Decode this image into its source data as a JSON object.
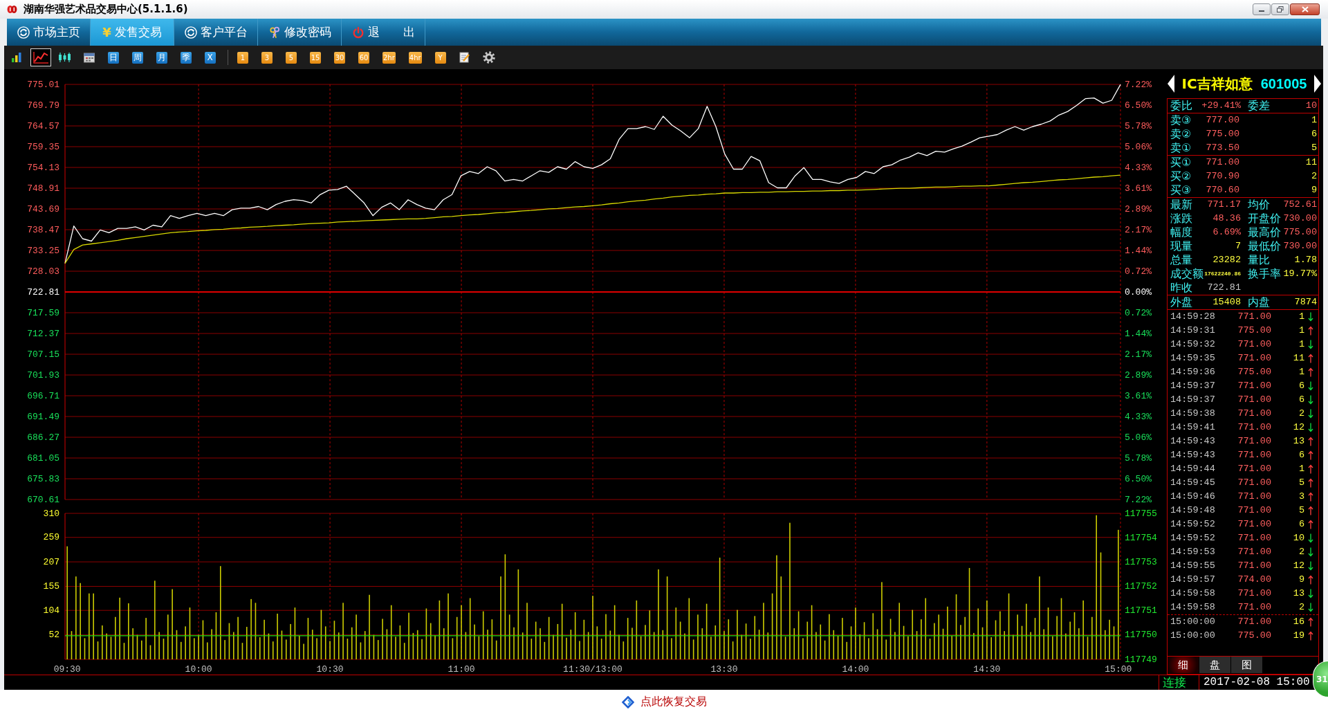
{
  "window": {
    "title": "湖南华强艺术品交易中心(5.1.1.6)"
  },
  "menu": [
    {
      "label": "市场主页",
      "kind": "refresh",
      "selected": false
    },
    {
      "label": "发售交易",
      "kind": "symbol",
      "symbol": "¥",
      "selected": true
    },
    {
      "label": "客户平台",
      "kind": "refresh",
      "selected": false
    },
    {
      "label": "修改密码",
      "kind": "keys",
      "selected": false
    },
    {
      "label": "退　　出",
      "kind": "power",
      "selected": false
    }
  ],
  "toolbar": {
    "chart_types": [
      {
        "kind": "bars",
        "selected": false
      },
      {
        "kind": "line",
        "selected": true
      },
      {
        "kind": "candles",
        "selected": false
      },
      {
        "kind": "calendar",
        "selected": false
      }
    ],
    "periods": [
      "日",
      "周",
      "月",
      "季",
      "X"
    ],
    "intervals": [
      "1",
      "3",
      "5",
      "15",
      "30",
      "60",
      "2hr",
      "4hr",
      "Y"
    ],
    "tools": [
      {
        "kind": "note"
      },
      {
        "kind": "settings"
      }
    ]
  },
  "price_chart": {
    "chart_data": {
      "type": "line",
      "grid": true,
      "ylim": [
        670.61,
        775.01
      ],
      "categories": [
        null,
        null,
        null,
        null,
        null,
        null,
        null,
        null,
        null,
        null,
        null,
        null,
        null,
        null,
        null,
        null,
        null,
        null,
        null,
        null,
        null,
        null,
        null,
        null,
        null,
        null,
        null,
        null,
        null,
        null,
        null,
        null,
        null,
        null,
        null,
        null,
        null,
        null,
        null,
        null,
        null,
        null,
        null,
        null,
        null,
        null,
        null,
        null,
        null,
        null,
        null,
        null,
        null,
        null,
        null,
        null,
        null,
        null,
        null,
        null,
        null,
        null,
        null,
        null,
        null,
        null,
        null,
        null,
        null,
        null,
        null,
        null,
        null,
        null,
        null,
        null,
        null,
        null,
        null,
        null,
        null,
        null,
        null,
        null,
        null,
        null,
        null,
        null,
        null,
        null,
        null,
        null,
        null,
        null,
        null,
        null,
        null,
        null,
        null,
        null,
        null,
        null,
        null,
        null,
        null,
        null,
        null,
        null,
        null,
        null,
        null,
        null,
        null,
        null,
        null,
        null,
        null,
        null,
        null,
        null,
        null
      ],
      "series": [
        {
          "color": "#ffffff",
          "values": [
            730,
            739.4,
            736.2,
            735.6,
            738.4,
            737.7,
            738.8,
            738.8,
            739.2,
            738.4,
            739.6,
            739.2,
            742,
            741.3,
            742,
            742.6,
            742,
            742.6,
            742,
            743.5,
            743.9,
            743.9,
            744.3,
            743.5,
            744.8,
            745.6,
            746,
            745.8,
            745.2,
            747.3,
            748.4,
            748.6,
            749.4,
            747.3,
            745.2,
            742,
            744.1,
            745.2,
            743.5,
            746,
            744.8,
            743.9,
            743.5,
            746,
            747.3,
            752,
            753.1,
            752.6,
            754.3,
            753.3,
            750.7,
            751.1,
            750.7,
            752,
            753.3,
            752.9,
            754.3,
            753.7,
            755.6,
            754.3,
            753.9,
            754.8,
            756.3,
            761.2,
            763.9,
            763.9,
            764.4,
            763.7,
            767,
            764.8,
            763.3,
            761.6,
            763.9,
            769.5,
            764.4,
            757.5,
            753.7,
            753.7,
            756.9,
            755.8,
            750.3,
            749,
            749,
            752,
            754.1,
            751.1,
            751.1,
            750.5,
            750.1,
            751.1,
            751.6,
            753.1,
            752.6,
            754.3,
            754.8,
            756,
            756.7,
            757.8,
            757.1,
            758.2,
            758,
            758.8,
            759.5,
            760.5,
            761.6,
            762,
            762.4,
            763.5,
            764.4,
            763.5,
            764.4,
            765,
            765.8,
            767.3,
            768.2,
            769.7,
            771.4,
            771.6,
            770.3,
            771,
            775
          ]
        },
        {
          "color": "#d8d800",
          "values": [
            730,
            733.5,
            734.6,
            734.9,
            735.2,
            735.5,
            735.8,
            736.2,
            736.5,
            736.8,
            737.1,
            737.4,
            737.7,
            737.9,
            738,
            738.2,
            738.3,
            738.5,
            738.6,
            738.8,
            738.9,
            739.1,
            739.2,
            739.3,
            739.5,
            739.6,
            739.7,
            739.9,
            740,
            740.1,
            740.2,
            740.4,
            740.5,
            740.6,
            740.7,
            740.8,
            740.9,
            741,
            741.1,
            741.2,
            741.2,
            741.3,
            741.5,
            741.7,
            741.8,
            742,
            742.2,
            742.3,
            742.5,
            742.7,
            742.8,
            743,
            743.2,
            743.3,
            743.5,
            743.7,
            743.8,
            744,
            744.2,
            744.3,
            744.5,
            744.7,
            745,
            745.2,
            745.5,
            745.7,
            745.9,
            746.2,
            746.4,
            746.7,
            746.9,
            747.1,
            747.2,
            747.4,
            747.5,
            747.7,
            747.7,
            747.8,
            747.8,
            747.9,
            747.9,
            748,
            748,
            748.1,
            748.1,
            748.2,
            748.2,
            748.3,
            748.3,
            748.4,
            748.4,
            748.5,
            748.6,
            748.7,
            748.8,
            748.9,
            748.9,
            749,
            749.1,
            749.2,
            749.2,
            749.3,
            749.4,
            749.4,
            749.5,
            749.5,
            749.7,
            749.9,
            750.1,
            750.3,
            750.4,
            750.6,
            750.8,
            751,
            751.1,
            751.3,
            751.5,
            751.7,
            751.8,
            752,
            752.2
          ]
        }
      ],
      "yticks": [
        775.01,
        769.79,
        764.57,
        759.35,
        754.13,
        748.91,
        743.69,
        738.47,
        733.25,
        728.03,
        722.81,
        717.59,
        712.37,
        707.15,
        701.93,
        696.71,
        691.49,
        686.27,
        681.05,
        675.83,
        670.61
      ],
      "ref_lines": [
        {
          "axis": "y",
          "value": 722.81
        }
      ]
    },
    "percent_labels": [
      "7.22%",
      "6.50%",
      "5.78%",
      "5.06%",
      "4.33%",
      "3.61%",
      "2.89%",
      "2.17%",
      "1.44%",
      "0.72%",
      "0.00%",
      "0.72%",
      "1.44%",
      "2.17%",
      "2.89%",
      "3.61%",
      "4.33%",
      "5.06%",
      "5.78%",
      "6.50%",
      "7.22%"
    ]
  },
  "volume_chart": {
    "chart_data": {
      "type": "bar",
      "grid": true,
      "ylim": [
        0,
        310
      ],
      "categories": [
        "09:30",
        null,
        null,
        null,
        null,
        null,
        null,
        null,
        null,
        null,
        null,
        null,
        null,
        null,
        null,
        null,
        null,
        null,
        null,
        null,
        null,
        null,
        null,
        null,
        null,
        null,
        null,
        null,
        null,
        null,
        "10:00",
        null,
        null,
        null,
        null,
        null,
        null,
        null,
        null,
        null,
        null,
        null,
        null,
        null,
        null,
        null,
        null,
        null,
        null,
        null,
        null,
        null,
        null,
        null,
        null,
        null,
        null,
        null,
        null,
        null,
        "10:30",
        null,
        null,
        null,
        null,
        null,
        null,
        null,
        null,
        null,
        null,
        null,
        null,
        null,
        null,
        null,
        null,
        null,
        null,
        null,
        null,
        null,
        null,
        null,
        null,
        null,
        null,
        null,
        null,
        null,
        "11:00",
        null,
        null,
        null,
        null,
        null,
        null,
        null,
        null,
        null,
        null,
        null,
        null,
        null,
        null,
        null,
        null,
        null,
        null,
        null,
        null,
        null,
        null,
        null,
        null,
        null,
        null,
        null,
        null,
        null,
        "11:30/13:00",
        null,
        null,
        null,
        null,
        null,
        null,
        null,
        null,
        null,
        null,
        null,
        null,
        null,
        null,
        null,
        null,
        null,
        null,
        null,
        null,
        null,
        null,
        null,
        null,
        null,
        null,
        null,
        null,
        null,
        "13:30",
        null,
        null,
        null,
        null,
        null,
        null,
        null,
        null,
        null,
        null,
        null,
        null,
        null,
        null,
        null,
        null,
        null,
        null,
        null,
        null,
        null,
        null,
        null,
        null,
        null,
        null,
        null,
        null,
        null,
        "14:00",
        null,
        null,
        null,
        null,
        null,
        null,
        null,
        null,
        null,
        null,
        null,
        null,
        null,
        null,
        null,
        null,
        null,
        null,
        null,
        null,
        null,
        null,
        null,
        null,
        null,
        null,
        null,
        null,
        null,
        "14:30",
        null,
        null,
        null,
        null,
        null,
        null,
        null,
        null,
        null,
        null,
        null,
        null,
        null,
        null,
        null,
        null,
        null,
        null,
        null,
        null,
        null,
        null,
        null,
        null,
        null,
        null,
        null,
        null,
        null,
        "15:00"
      ],
      "values": [
        240,
        60,
        176,
        162,
        45,
        140,
        140,
        38,
        72,
        55,
        48,
        90,
        131,
        35,
        119,
        66,
        52,
        40,
        88,
        30,
        167,
        58,
        44,
        95,
        149,
        62,
        37,
        70,
        110,
        45,
        52,
        83,
        36,
        64,
        100,
        198,
        41,
        77,
        58,
        90,
        35,
        69,
        128,
        120,
        47,
        84,
        55,
        38,
        97,
        61,
        42,
        75,
        110,
        50,
        33,
        88,
        63,
        45,
        105,
        70,
        39,
        82,
        57,
        120,
        44,
        68,
        95,
        36,
        60,
        137,
        52,
        41,
        86,
        64,
        115,
        48,
        72,
        35,
        99,
        56,
        62,
        43,
        108,
        77,
        51,
        125,
        66,
        140,
        45,
        90,
        115,
        58,
        130,
        74,
        49,
        102,
        63,
        85,
        40,
        176,
        223,
        95,
        68,
        191,
        57,
        120,
        44,
        80,
        66,
        37,
        90,
        52,
        75,
        118,
        46,
        63,
        100,
        39,
        84,
        58,
        135,
        70,
        44,
        96,
        61,
        115,
        52,
        38,
        88,
        67,
        125,
        49,
        73,
        104,
        58,
        191,
        62,
        176,
        45,
        110,
        80,
        55,
        130,
        42,
        95,
        66,
        118,
        48,
        72,
        216,
        60,
        85,
        38,
        105,
        52,
        76,
        44,
        92,
        63,
        120,
        57,
        140,
        221,
        176,
        48,
        290,
        66,
        102,
        45,
        80,
        115,
        58,
        74,
        40,
        96,
        62,
        50,
        88,
        37,
        70,
        110,
        53,
        79,
        45,
        98,
        64,
        164,
        42,
        86,
        58,
        120,
        71,
        49,
        105,
        60,
        85,
        130,
        44,
        77,
        95,
        65,
        112,
        50,
        138,
        73,
        90,
        194,
        56,
        108,
        68,
        125,
        47,
        83,
        102,
        60,
        140,
        52,
        95,
        71,
        118,
        58,
        88,
        176,
        64,
        110,
        49,
        92,
        130,
        55,
        80,
        100,
        66,
        125,
        48,
        90,
        306,
        227,
        62,
        84,
        70,
        275
      ],
      "yticks": [
        310,
        259,
        207,
        155,
        104,
        52
      ],
      "ref_lines": [
        {
          "axis": "y",
          "value": 50
        }
      ]
    },
    "right_axis_labels": [
      "117755",
      "117754",
      "117753",
      "117752",
      "117751",
      "117750",
      "117749"
    ]
  },
  "quote_panel": {
    "name": "IC吉祥如意",
    "code": "601005",
    "order_ratio": {
      "label": "委比",
      "value": "+29.41%"
    },
    "order_diff": {
      "label": "委差",
      "value": "10"
    },
    "asks": [
      {
        "label": "卖③",
        "price": "777.00",
        "volume": "1"
      },
      {
        "label": "卖②",
        "price": "775.00",
        "volume": "6"
      },
      {
        "label": "卖①",
        "price": "773.50",
        "volume": "5"
      }
    ],
    "bids": [
      {
        "label": "买①",
        "price": "771.00",
        "volume": "11"
      },
      {
        "label": "买②",
        "price": "770.90",
        "volume": "2"
      },
      {
        "label": "买③",
        "price": "770.60",
        "volume": "9"
      }
    ],
    "stats": [
      {
        "label": "最新",
        "value": "771.17",
        "color": "#ff5f5f"
      },
      {
        "label": "均价",
        "value": "752.61",
        "color": "#ff5f5f"
      },
      {
        "label": "涨跌",
        "value": "48.36",
        "color": "#ff5f5f"
      },
      {
        "label": "开盘价",
        "value": "730.00",
        "color": "#ff5f5f"
      },
      {
        "label": "幅度",
        "value": "6.69%",
        "color": "#ff5f5f"
      },
      {
        "label": "最高价",
        "value": "775.00",
        "color": "#ff5f5f"
      },
      {
        "label": "现量",
        "value": "7",
        "color": "#ffff40"
      },
      {
        "label": "最低价",
        "value": "730.00",
        "color": "#ff5f5f"
      },
      {
        "label": "总量",
        "value": "23282",
        "color": "#ffff40"
      },
      {
        "label": "量比",
        "value": "1.78",
        "color": "#ffff40"
      },
      {
        "label": "成交额",
        "value": "17622240.86",
        "color": "#ffff40"
      },
      {
        "label": "换手率",
        "value": "19.77%",
        "color": "#ffff40"
      },
      {
        "label": "昨收",
        "value": "722.81",
        "color": "#c8c8c8"
      }
    ],
    "outer": {
      "label": "外盘",
      "value": "15408"
    },
    "inner": {
      "label": "内盘",
      "value": "7874"
    },
    "trades": [
      {
        "time": "14:59:28",
        "price": "771.00",
        "volume": "1",
        "up": false
      },
      {
        "time": "14:59:31",
        "price": "775.00",
        "volume": "1",
        "up": true
      },
      {
        "time": "14:59:32",
        "price": "771.00",
        "volume": "1",
        "up": false
      },
      {
        "time": "14:59:35",
        "price": "771.00",
        "volume": "11",
        "up": true
      },
      {
        "time": "14:59:36",
        "price": "775.00",
        "volume": "1",
        "up": true
      },
      {
        "time": "14:59:37",
        "price": "771.00",
        "volume": "6",
        "up": false
      },
      {
        "time": "14:59:37",
        "price": "771.00",
        "volume": "6",
        "up": false
      },
      {
        "time": "14:59:38",
        "price": "771.00",
        "volume": "2",
        "up": false
      },
      {
        "time": "14:59:41",
        "price": "771.00",
        "volume": "12",
        "up": false
      },
      {
        "time": "14:59:43",
        "price": "771.00",
        "volume": "13",
        "up": true
      },
      {
        "time": "14:59:43",
        "price": "771.00",
        "volume": "6",
        "up": true
      },
      {
        "time": "14:59:44",
        "price": "771.00",
        "volume": "1",
        "up": true
      },
      {
        "time": "14:59:45",
        "price": "771.00",
        "volume": "5",
        "up": true
      },
      {
        "time": "14:59:46",
        "price": "771.00",
        "volume": "3",
        "up": true
      },
      {
        "time": "14:59:48",
        "price": "771.00",
        "volume": "5",
        "up": true
      },
      {
        "time": "14:59:52",
        "price": "771.00",
        "volume": "6",
        "up": true
      },
      {
        "time": "14:59:52",
        "price": "771.00",
        "volume": "10",
        "up": false
      },
      {
        "time": "14:59:53",
        "price": "771.00",
        "volume": "2",
        "up": false
      },
      {
        "time": "14:59:55",
        "price": "771.00",
        "volume": "12",
        "up": false
      },
      {
        "time": "14:59:57",
        "price": "774.00",
        "volume": "9",
        "up": true
      },
      {
        "time": "14:59:58",
        "price": "771.00",
        "volume": "13",
        "up": false
      },
      {
        "time": "14:59:58",
        "price": "771.00",
        "volume": "2",
        "up": false
      }
    ],
    "closing_trades": [
      {
        "time": "15:00:00",
        "price": "771.00",
        "volume": "16",
        "up": true
      },
      {
        "time": "15:00:00",
        "price": "775.00",
        "volume": "19",
        "up": true
      }
    ],
    "tabs": [
      {
        "label": "细",
        "selected": true
      },
      {
        "label": "盘",
        "selected": false
      },
      {
        "label": "图",
        "selected": false
      }
    ]
  },
  "status_bar": {
    "connection": "连接",
    "datetime": "2017-02-08 15:00"
  },
  "footer": {
    "link": "点此恢复交易"
  },
  "floating_badge": {
    "label": "31"
  }
}
